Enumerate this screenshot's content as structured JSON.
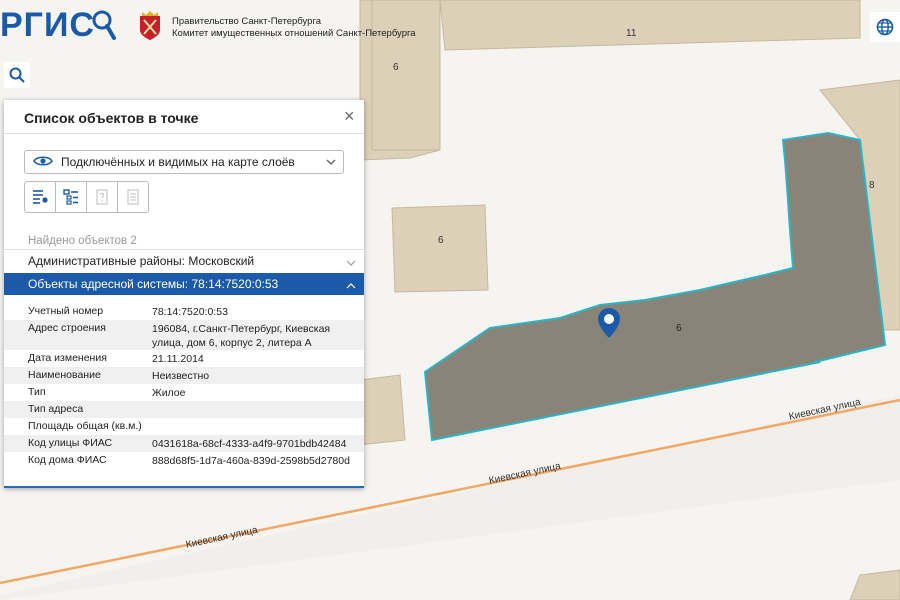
{
  "header": {
    "logo": "РГИС",
    "government_line1": "Правительство Санкт-Петербурга",
    "government_line2": "Комитет имущественных отношений Санкт-Петербурга"
  },
  "map": {
    "building_labels": [
      "6",
      "11",
      "8",
      "6",
      "6"
    ],
    "street_label": "Киевская улица"
  },
  "panel": {
    "title": "Список объектов в точке",
    "close_glyph": "×",
    "layers_select": "Подключённых и видимых на карте слоёв",
    "found_text": "Найдено объектов 2",
    "admin_section": "Административные районы: Московский",
    "address_section": "Объекты адресной системы: 78:14:7520:0:53",
    "attributes": [
      {
        "key": "Учетный номер",
        "value": "78:14:7520:0:53"
      },
      {
        "key": "Адрес строения",
        "value": "196084, г.Санкт-Петербург, Киевская улица, дом 6, корпус 2, литера А"
      },
      {
        "key": "Дата изменения",
        "value": "21.11.2014"
      },
      {
        "key": "Наименование",
        "value": "Неизвестно"
      },
      {
        "key": "Тип",
        "value": "Жилое"
      },
      {
        "key": "Тип адреса",
        "value": ""
      },
      {
        "key": "Площадь общая (кв.м.)",
        "value": ""
      },
      {
        "key": "Код улицы ФИАС",
        "value": "0431618a-68cf-4333-a4f9-9701bdb42484"
      },
      {
        "key": "Код дома ФИАС",
        "value": "888d68f5-1d7a-460a-839d-2598b5d2780d"
      }
    ]
  },
  "colors": {
    "brand_blue": "#1a5aa8",
    "building_fill": "#ddd0b8",
    "selected_fill": "#8a8378",
    "selected_outline": "#2bb5c4",
    "street_line": "#f2a864"
  },
  "icons": [
    "search-icon",
    "globe-icon",
    "layers-eye-icon",
    "chevron-down-icon",
    "chevron-up-icon",
    "map-pin-icon"
  ]
}
